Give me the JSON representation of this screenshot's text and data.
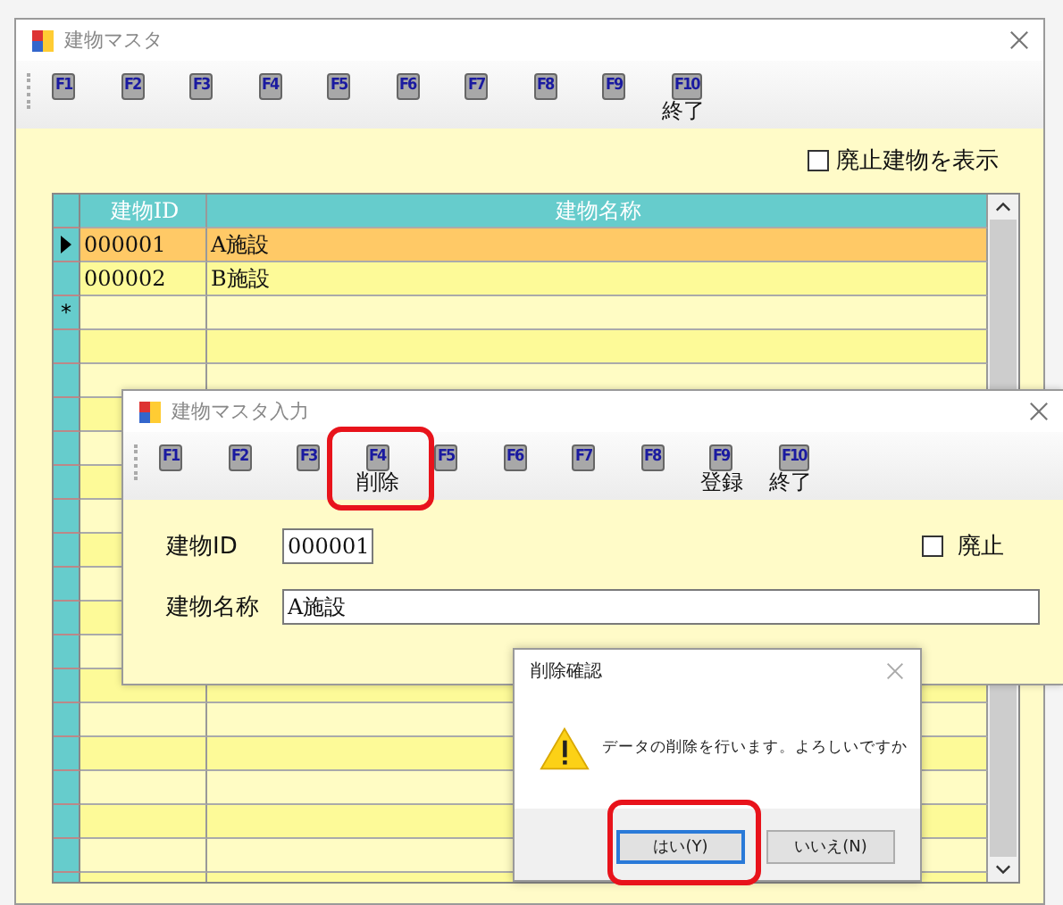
{
  "main_window": {
    "title": "建物マスタ",
    "function_keys": [
      {
        "key": "F1"
      },
      {
        "key": "F2"
      },
      {
        "key": "F3"
      },
      {
        "key": "F4"
      },
      {
        "key": "F5"
      },
      {
        "key": "F6"
      },
      {
        "key": "F7"
      },
      {
        "key": "F8"
      },
      {
        "key": "F9"
      },
      {
        "key": "F10",
        "label": "終了"
      }
    ],
    "show_retired": {
      "label": "廃止建物を表示",
      "checked": false
    },
    "grid": {
      "columns": [
        "建物ID",
        "建物名称"
      ],
      "rows": [
        {
          "id": "000001",
          "name": "A施設",
          "selected": true
        },
        {
          "id": "000002",
          "name": "B施設",
          "selected": false
        }
      ],
      "new_row_marker": "*"
    }
  },
  "entry_window": {
    "title": "建物マスタ入力",
    "function_keys": [
      {
        "key": "F1",
        "highlighted": false
      },
      {
        "key": "F2",
        "highlighted": false
      },
      {
        "key": "F3",
        "highlighted": false
      },
      {
        "key": "F4",
        "label": "削除",
        "highlighted": true
      },
      {
        "key": "F5",
        "highlighted": false
      },
      {
        "key": "F6",
        "highlighted": false
      },
      {
        "key": "F7",
        "highlighted": false
      },
      {
        "key": "F8",
        "highlighted": false
      },
      {
        "key": "F9",
        "label": "登録",
        "highlighted": false
      },
      {
        "key": "F10",
        "label": "終了",
        "highlighted": false
      }
    ],
    "fields": [
      {
        "label": "建物ID",
        "value": "000001",
        "kind": "code"
      },
      {
        "label": "建物名称",
        "value": "A施設",
        "kind": "text"
      }
    ],
    "retired": {
      "label": "廃止",
      "checked": false
    }
  },
  "dialog": {
    "title": "削除確認",
    "message": "データの削除を行います。よろしいですか",
    "buttons": [
      {
        "label": "はい(Y)",
        "selected": true,
        "highlighted": true
      },
      {
        "label": "いいえ(N)",
        "selected": false,
        "highlighted": false
      }
    ]
  }
}
